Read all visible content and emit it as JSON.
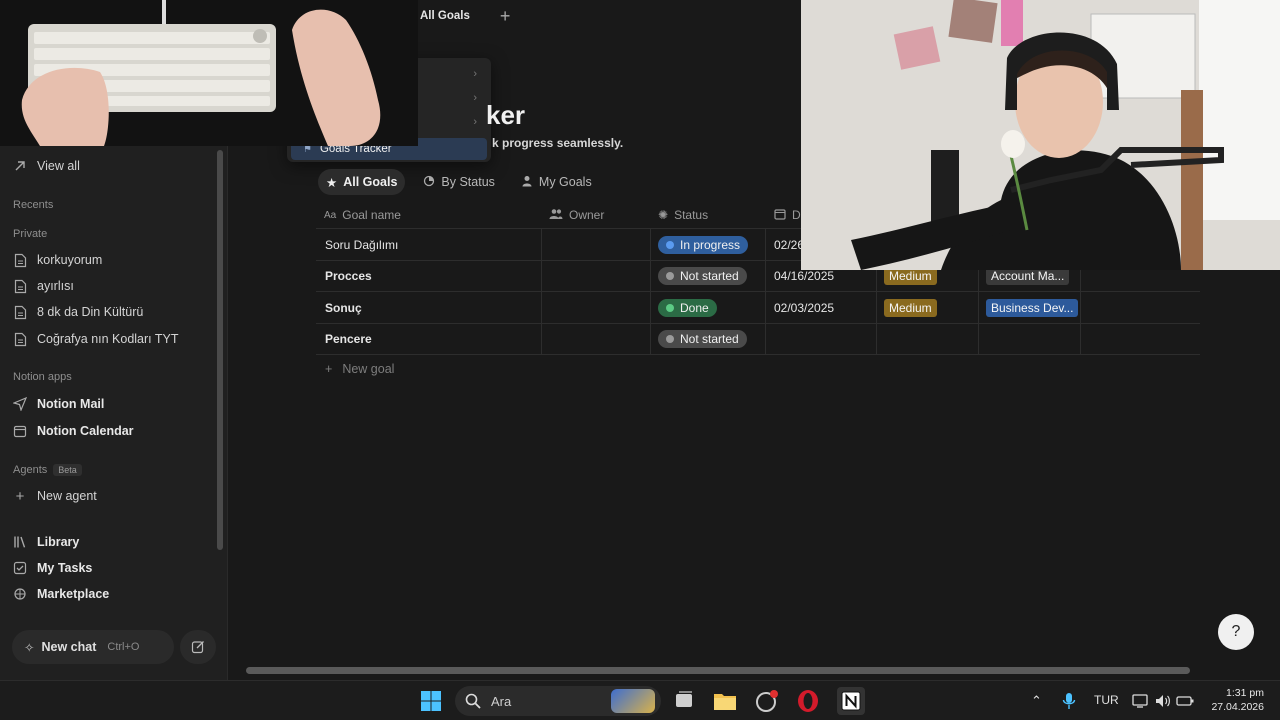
{
  "tabs": {
    "active": "All Goals",
    "add_label": "+"
  },
  "dropdown": {
    "selected": "Goals Tracker"
  },
  "page": {
    "title_partial": "ker",
    "description_partial": "k progress seamlessly."
  },
  "views": [
    {
      "label": "All Goals",
      "icon": "star-icon"
    },
    {
      "label": "By Status",
      "icon": "status-icon"
    },
    {
      "label": "My Goals",
      "icon": "person-icon"
    }
  ],
  "columns": {
    "name": "Goal name",
    "owner": "Owner",
    "status": "Status",
    "date": "D"
  },
  "rows": [
    {
      "name": "Soru Dağılımı",
      "status": "In progress",
      "date": "02/26",
      "priority": "",
      "category": ""
    },
    {
      "name": "Procces",
      "status": "Not started",
      "date": "04/16/2025",
      "priority": "Medium",
      "category": "Account Ma..."
    },
    {
      "name": "Sonuç",
      "status": "Done",
      "date": "02/03/2025",
      "priority": "Medium",
      "category": "Business Dev..."
    },
    {
      "name": "Pencere",
      "status": "Not started",
      "date": "",
      "priority": "",
      "category": ""
    }
  ],
  "new_goal": "New goal",
  "sidebar": {
    "view_all": "View all",
    "recents": "Recents",
    "private": "Private",
    "pages": [
      "korkuyorum",
      "ayırlısı",
      "8 dk da Din Kültürü",
      "Coğrafya nın Kodları TYT"
    ],
    "notion_apps": "Notion apps",
    "apps": [
      "Notion Mail",
      "Notion Calendar"
    ],
    "agents": "Agents",
    "beta": "Beta",
    "new_agent": "New agent",
    "bottom": [
      "Library",
      "My Tasks",
      "Marketplace"
    ],
    "new_chat": "New chat",
    "new_chat_shortcut": "Ctrl+O"
  },
  "taskbar": {
    "search": "Ara",
    "lang": "TUR",
    "time": "1:31 pm",
    "date": "27.04.2026"
  },
  "colors": {
    "in_progress": "#2f5f9e",
    "not_started": "#4a4a4a",
    "done": "#2b6b45",
    "medium": "#8a6a1f",
    "account": "#3a3a3a",
    "business": "#2d5a9b"
  }
}
